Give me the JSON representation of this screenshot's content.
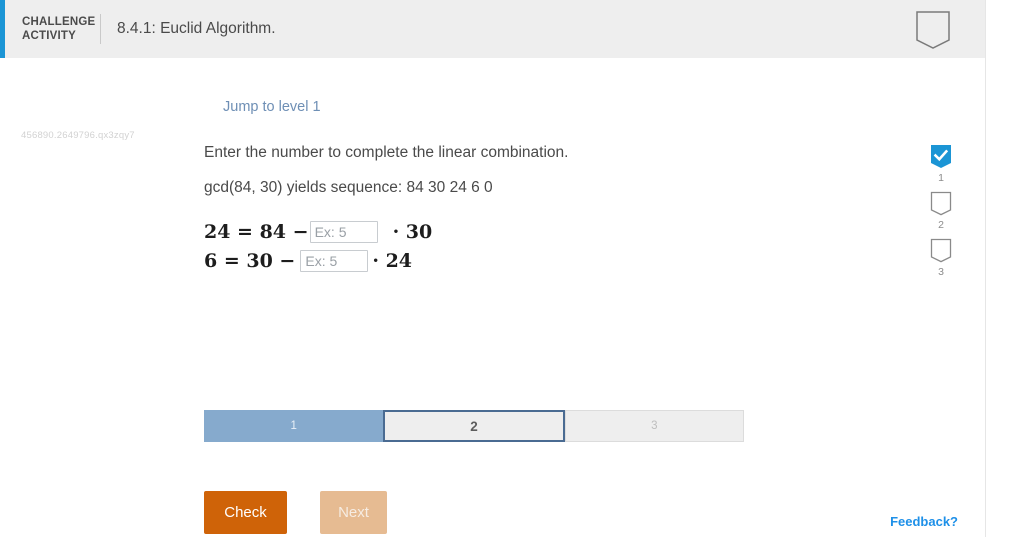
{
  "header": {
    "kicker": "CHALLENGE ACTIVITY",
    "title": "8.4.1: Euclid Algorithm.",
    "pennant_icon": "pennant-outline-icon"
  },
  "body": {
    "quiz_id": "456890.2649796.qx3zqy7",
    "jump_link": "Jump to level 1",
    "prompt": "Enter the number to complete the linear combination.",
    "sequence": "gcd(84, 30) yields sequence: 84 30 24 6 0"
  },
  "equations": [
    {
      "lhs": "24 = 84 −",
      "input_value": "",
      "input_placeholder": "Ex: 5",
      "rhs": "· 30"
    },
    {
      "lhs": "6 = 30 −",
      "input_value": "",
      "input_placeholder": "Ex: 5",
      "rhs": "· 24"
    }
  ],
  "level_bar": [
    {
      "label": "1",
      "state": "done"
    },
    {
      "label": "2",
      "state": "current"
    },
    {
      "label": "3",
      "state": "todo"
    }
  ],
  "actions": {
    "check_label": "Check",
    "next_label": "Next"
  },
  "rail": [
    {
      "number": "1",
      "state": "checked",
      "icon": "pennant-checked-icon"
    },
    {
      "number": "2",
      "state": "empty",
      "icon": "pennant-outline-icon"
    },
    {
      "number": "3",
      "state": "empty",
      "icon": "pennant-outline-icon"
    }
  ],
  "feedback": {
    "label": "Feedback?"
  },
  "colors": {
    "header_accent": "#1b95d5",
    "header_bg": "#eeeeee",
    "link": "#6e8fb5",
    "check_button": "#cf6308",
    "next_button": "#e6bb92",
    "level_done": "#86aacd",
    "level_current_border": "#4a6b92",
    "pennant_checked": "#1b95d5",
    "feedback_link": "#1e90e8"
  }
}
